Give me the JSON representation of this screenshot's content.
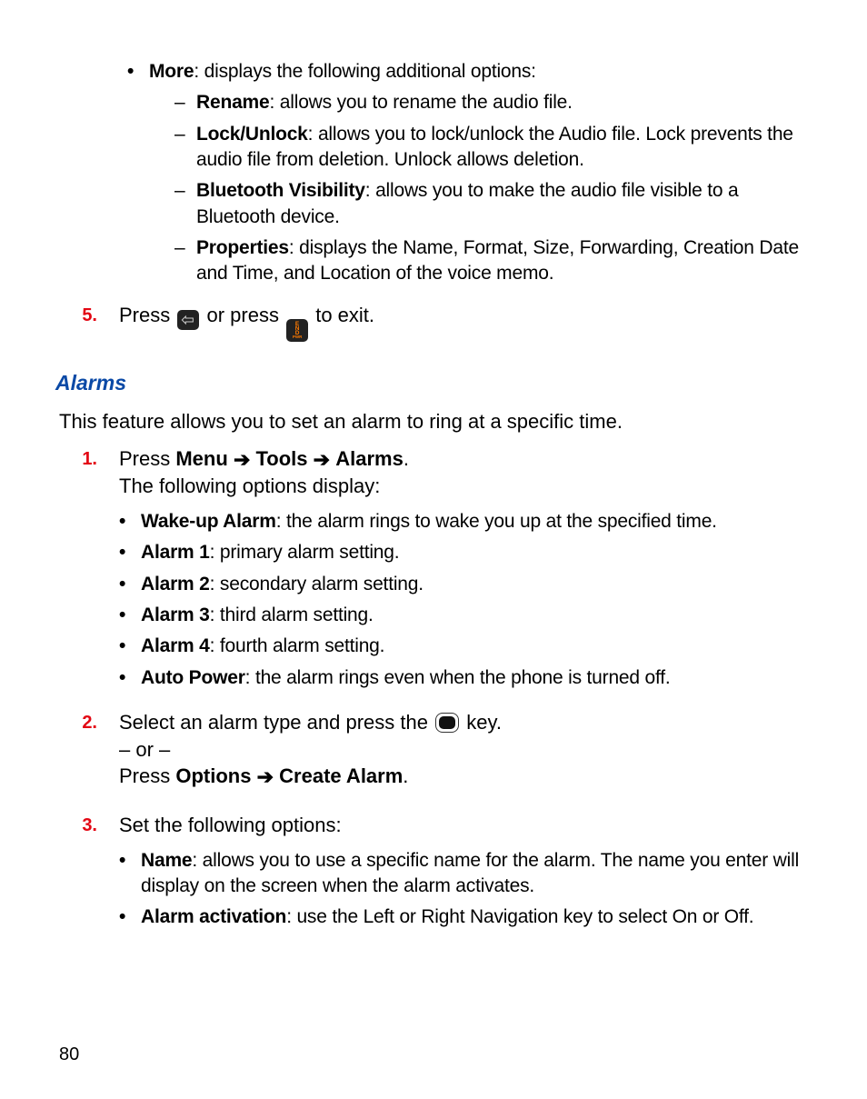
{
  "more": {
    "label": "More",
    "desc": ": displays the following additional options:",
    "items": [
      {
        "label": "Rename",
        "desc": ": allows you to rename the audio file."
      },
      {
        "label": "Lock/Unlock",
        "desc": ": allows you to lock/unlock the Audio file. Lock prevents the audio file from deletion. Unlock allows deletion."
      },
      {
        "label": "Bluetooth Visibility",
        "desc": ": allows you to make the audio file visible to a Bluetooth device."
      },
      {
        "label": "Properties",
        "desc": ": displays the Name, Format, Size, Forwarding, Creation Date and Time, and Location of the voice memo."
      }
    ]
  },
  "step5": {
    "num": "5.",
    "press1": "Press ",
    "orpress": " or press ",
    "exit": " to exit."
  },
  "alarms": {
    "title": "Alarms",
    "intro": "This feature allows you to set an alarm to ring at a specific time.",
    "step1": {
      "num": "1.",
      "press": "Press ",
      "menu": "Menu",
      "tools": "Tools",
      "alarms": "Alarms",
      "dot": ".",
      "following": "The following options display:",
      "options": [
        {
          "label": "Wake-up Alarm",
          "desc": ": the alarm rings to wake you up at the specified time."
        },
        {
          "label": "Alarm 1",
          "desc": ": primary alarm setting."
        },
        {
          "label": "Alarm 2",
          "desc": ": secondary alarm setting."
        },
        {
          "label": "Alarm 3",
          "desc": ": third alarm setting."
        },
        {
          "label": "Alarm 4",
          "desc": ": fourth alarm setting."
        },
        {
          "label": "Auto Power",
          "desc": ": the alarm rings even when the phone is turned off."
        }
      ]
    },
    "step2": {
      "num": "2.",
      "line1a": "Select an alarm type and press the ",
      "line1b": " key.",
      "or": "– or –",
      "press": "Press ",
      "options": "Options",
      "create": "Create Alarm",
      "dot": "."
    },
    "step3": {
      "num": "3.",
      "lead": "Set the following options:",
      "options": [
        {
          "label": "Name",
          "desc": ": allows you to use a specific name for the alarm. The name you enter will display on the screen when the alarm activates."
        },
        {
          "label": "Alarm activation",
          "desc": ": use the Left or Right Navigation key to select On or Off."
        }
      ]
    }
  },
  "icons": {
    "end_lines": [
      "E",
      "N",
      "D",
      "PWR"
    ]
  },
  "arrow": "➔",
  "pagenum": "80"
}
